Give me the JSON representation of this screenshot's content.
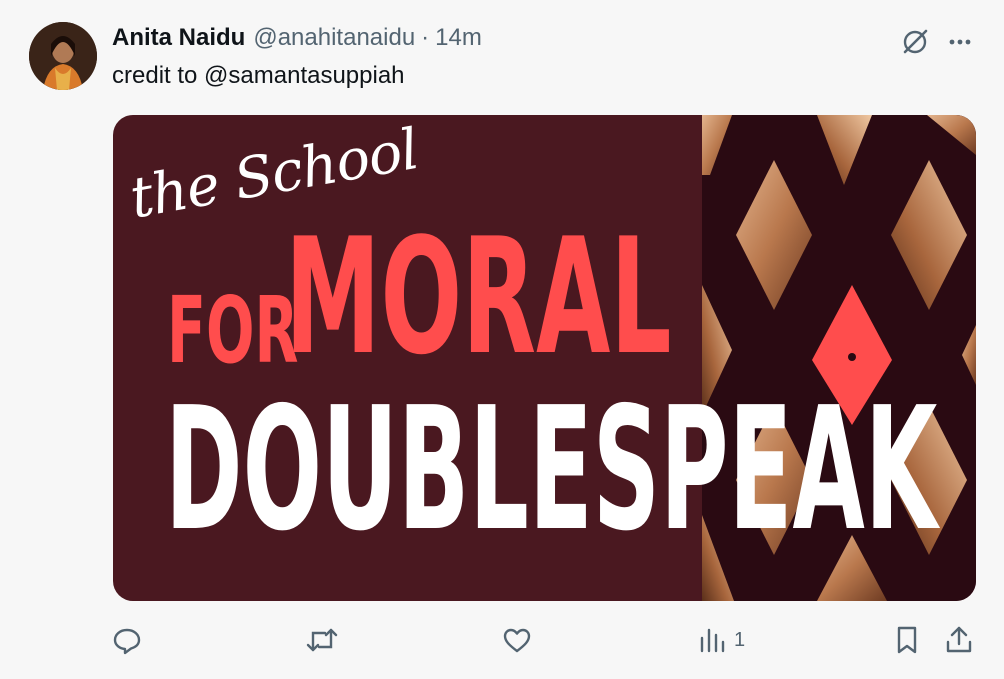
{
  "tweet": {
    "author_name": "Anita Naidu",
    "handle": "@anahitanaidu",
    "separator": "·",
    "time": "14m",
    "text": "credit to @samantasuppiah"
  },
  "media": {
    "script_text": "the School",
    "line1_for": "FOR",
    "line1_moral": "MORAL",
    "line2": "DOUBLESPEAK",
    "colors": {
      "background": "#4a1820",
      "accent_red": "#ff4d4d",
      "diamond_copper": "#c48a5e",
      "white": "#ffffff"
    }
  },
  "actions": {
    "views_count": "1"
  },
  "icons": {
    "top_right": [
      "grok-icon",
      "more-icon"
    ],
    "bottom": [
      "reply-icon",
      "retweet-icon",
      "like-icon",
      "views-icon",
      "bookmark-icon",
      "share-icon"
    ]
  }
}
